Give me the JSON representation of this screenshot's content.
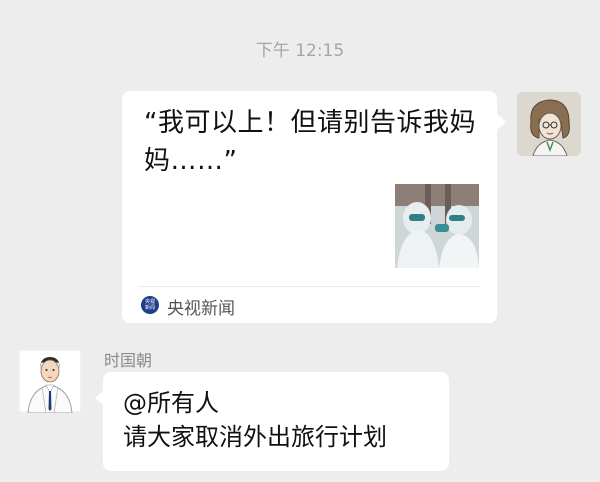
{
  "chat": {
    "timestamp": "下午 12:15"
  },
  "share_card": {
    "title": "“我可以上！但请别告诉我妈妈……”",
    "source_name": "央视新闻",
    "source_logo_text": "央视新闻"
  },
  "message": {
    "sender_name": "时国朝",
    "mention": "@所有人",
    "text": "请大家取消外出旅行计划"
  },
  "colors": {
    "chat_background": "#ededed",
    "bubble_background": "#ffffff",
    "source_logo": "#1f3d8a"
  },
  "icons": {
    "self_avatar": "sketch-woman-avatar",
    "other_avatar": "doctor-avatar",
    "thumbnail": "medical-staff-photo"
  }
}
